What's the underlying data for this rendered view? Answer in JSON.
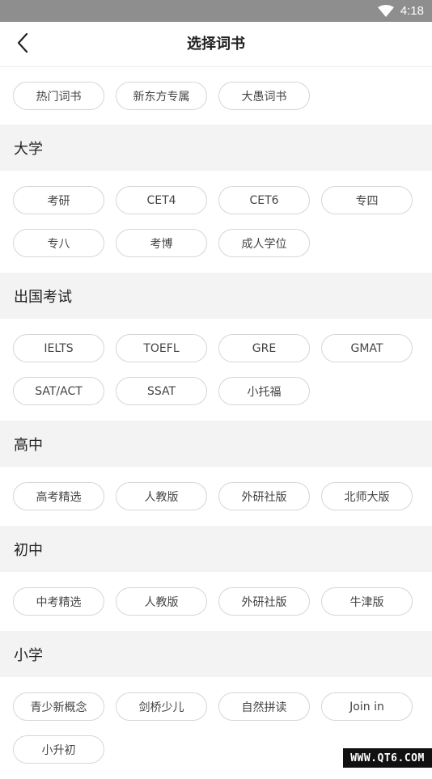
{
  "status_bar": {
    "time": "4:18"
  },
  "header": {
    "title": "选择词书"
  },
  "top_chips": [
    "热门词书",
    "新东方专属",
    "大愚词书"
  ],
  "sections": [
    {
      "title": "大学",
      "chips": [
        "考研",
        "CET4",
        "CET6",
        "专四",
        "专八",
        "考博",
        "成人学位"
      ]
    },
    {
      "title": "出国考试",
      "chips": [
        "IELTS",
        "TOEFL",
        "GRE",
        "GMAT",
        "SAT/ACT",
        "SSAT",
        "小托福"
      ]
    },
    {
      "title": "高中",
      "chips": [
        "高考精选",
        "人教版",
        "外研社版",
        "北师大版"
      ]
    },
    {
      "title": "初中",
      "chips": [
        "中考精选",
        "人教版",
        "外研社版",
        "牛津版"
      ]
    },
    {
      "title": "小学",
      "chips": [
        "青少新概念",
        "剑桥少儿",
        "自然拼读",
        "Join in",
        "小升初"
      ]
    }
  ],
  "watermark": "WWW.QT6.COM"
}
